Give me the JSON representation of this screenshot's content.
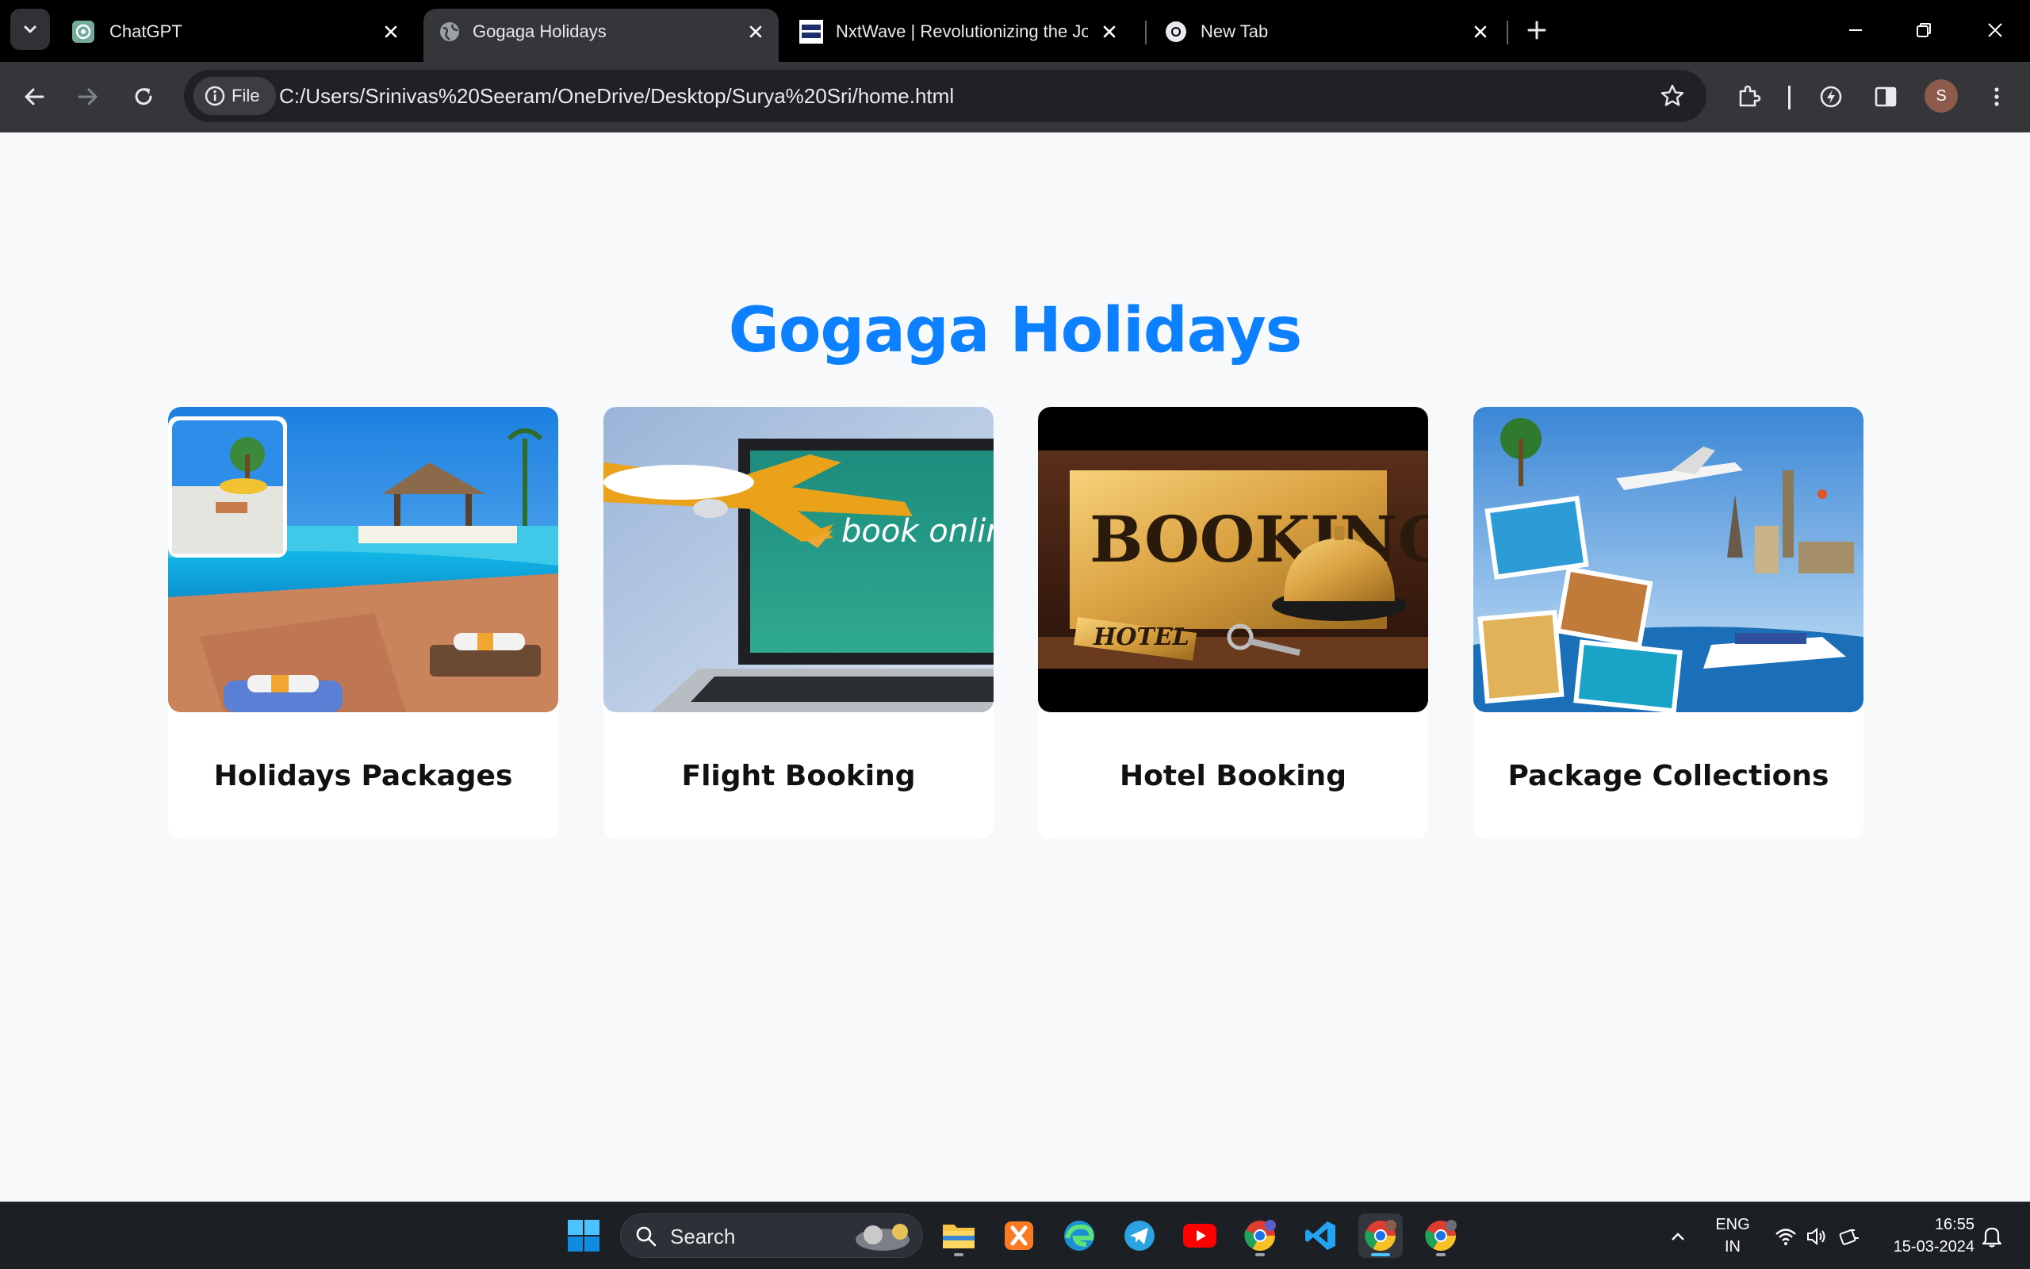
{
  "browser": {
    "tabs": [
      {
        "title": "ChatGPT",
        "favicon": "chatgpt-icon",
        "active": false
      },
      {
        "title": "Gogaga Holidays",
        "favicon": "globe-icon",
        "active": true
      },
      {
        "title": "NxtWave | Revolutionizing the Job",
        "favicon": "nxtwave-icon",
        "active": false
      },
      {
        "title": "New Tab",
        "favicon": "chrome-icon",
        "active": false
      }
    ],
    "site_chip_label": "File",
    "url": "C:/Users/Srinivas%20Seeram/OneDrive/Desktop/Surya%20Sri/home.html",
    "profile_initial": "S"
  },
  "page": {
    "heading": "Gogaga Holidays",
    "heading_color": "#0d80ff",
    "cards": [
      {
        "label": "Holidays Packages",
        "image": "resort-pool-image"
      },
      {
        "label": "Flight Booking",
        "image": "airplane-laptop-image",
        "image_text": "book onlin"
      },
      {
        "label": "Hotel Booking",
        "image": "booking-sign-bell-image",
        "image_text": "BOOKING",
        "tag_text": "HOTEL"
      },
      {
        "label": "Package Collections",
        "image": "travel-collage-image"
      }
    ]
  },
  "taskbar": {
    "search_placeholder": "Search",
    "apps": [
      "file-explorer-icon",
      "xampp-icon",
      "edge-icon",
      "telegram-icon",
      "youtube-icon",
      "chrome-icon",
      "vscode-icon",
      "chrome-icon",
      "chrome-icon"
    ],
    "language_line1": "ENG",
    "language_line2": "IN",
    "time": "16:55",
    "date": "15-03-2024"
  }
}
